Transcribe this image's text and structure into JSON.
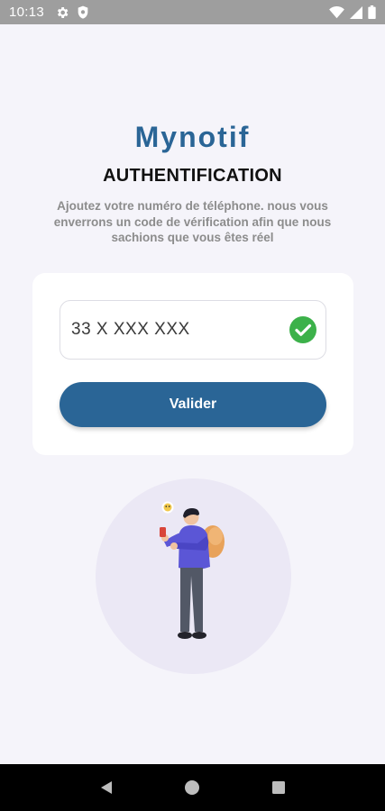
{
  "status_bar": {
    "time": "10:13",
    "left_icons": [
      "settings-icon",
      "shield-icon"
    ],
    "right_icons": [
      "wifi-icon",
      "signal-icon",
      "battery-icon"
    ]
  },
  "header": {
    "brand": "Mynotif",
    "title": "AUTHENTIFICATION",
    "description": "Ajoutez votre numéro de téléphone. nous vous enverrons un code de vérification afin que nous sachions que vous êtes réel"
  },
  "form": {
    "phone_value": "33 X XXX XXX",
    "phone_valid": true,
    "submit_label": "Valider"
  },
  "colors": {
    "brand": "#2a6596",
    "valid": "#3cb14a",
    "background": "#f5f4fa"
  },
  "nav_bar": {
    "buttons": [
      "back-icon",
      "home-icon",
      "recents-icon"
    ]
  }
}
